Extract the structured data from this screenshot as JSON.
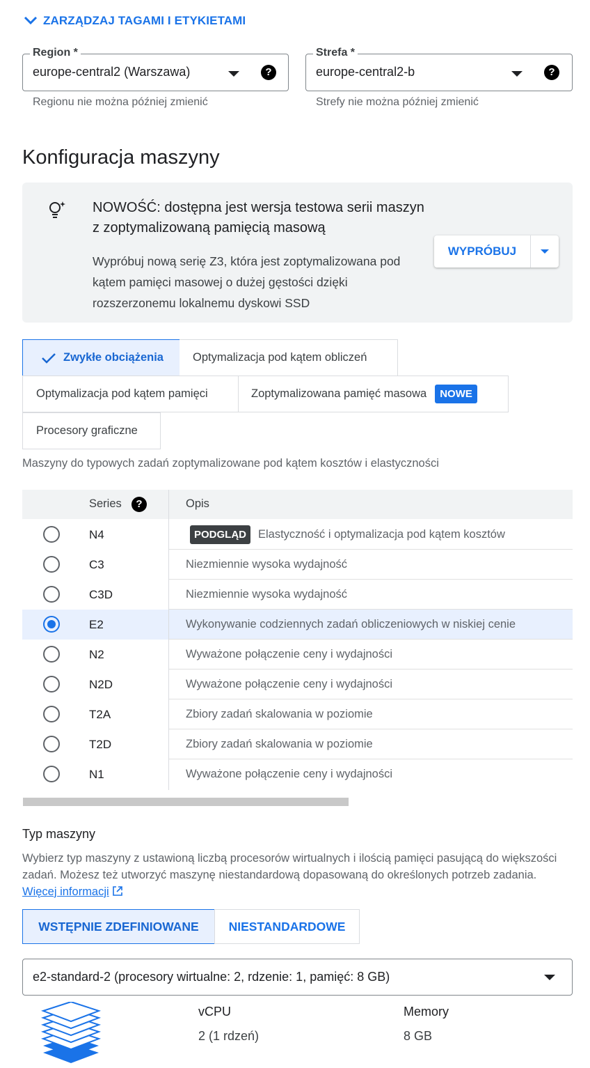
{
  "manage_tags": {
    "label": "ZARZĄDZAJ TAGAMI I ETYKIETAMI"
  },
  "region": {
    "label": "Region *",
    "value": "europe-central2 (Warszawa)",
    "hint": "Regionu nie można później zmienić"
  },
  "zone": {
    "label": "Strefa *",
    "value": "europe-central2-b",
    "hint": "Strefy nie można później zmienić"
  },
  "machine_config": {
    "title": "Konfiguracja maszyny"
  },
  "banner": {
    "title": "NOWOŚĆ: dostępna jest wersja testowa serii maszyn z zoptymalizowaną pamięcią masową",
    "description": "Wypróbuj nową serię Z3, która jest zoptymalizowana pod kątem pamięci masowej o dużej gęstości dzięki rozszerzonemu lokalnemu dyskowi SSD",
    "try_label": "WYPRÓBUJ"
  },
  "categories": {
    "general": "Zwykłe obciążenia",
    "compute": "Optymalizacja pod kątem obliczeń",
    "memory": "Optymalizacja pod kątem pamięci",
    "storage": "Zoptymalizowana pamięć masowa",
    "storage_badge": "NOWE",
    "gpu": "Procesory graficzne",
    "selected": "general",
    "description": "Maszyny do typowych zadań zoptymalizowane pod kątem kosztów i elastyczności"
  },
  "series_table": {
    "header_series": "Series",
    "header_desc": "Opis",
    "preview_badge": "PODGLĄD",
    "selected": "E2",
    "rows": [
      {
        "name": "N4",
        "desc": "Elastyczność i optymalizacja pod kątem kosztów"
      },
      {
        "name": "C3",
        "desc": "Niezmiennie wysoka wydajność"
      },
      {
        "name": "C3D",
        "desc": "Niezmiennie wysoka wydajność"
      },
      {
        "name": "E2",
        "desc": "Wykonywanie codziennych zadań obliczeniowych w niskiej cenie"
      },
      {
        "name": "N2",
        "desc": "Wyważone połączenie ceny i wydajności"
      },
      {
        "name": "N2D",
        "desc": "Wyważone połączenie ceny i wydajności"
      },
      {
        "name": "T2A",
        "desc": "Zbiory zadań skalowania w poziomie"
      },
      {
        "name": "T2D",
        "desc": "Zbiory zadań skalowania w poziomie"
      },
      {
        "name": "N1",
        "desc": "Wyważone połączenie ceny i wydajności"
      }
    ]
  },
  "machine_type": {
    "title": "Typ maszyny",
    "description": "Wybierz typ maszyny z ustawioną liczbą procesorów wirtualnych i ilością pamięci pasującą do większości zadań. Możesz też utworzyć maszynę niestandardową dopasowaną do określonych potrzeb zadania.",
    "learn_more": "Więcej informacji",
    "tab_predefined": "WSTĘPNIE ZDEFINIOWANE",
    "tab_custom": "NIESTANDARDOWE",
    "selected_tab": "predefined",
    "selected_value": "e2-standard-2 (procesory wirtualne: 2, rdzenie: 1, pamięć: 8 GB)",
    "vcpu_label": "vCPU",
    "vcpu_value": "2 (1 rdzeń)",
    "memory_label": "Memory",
    "memory_value": "8 GB"
  },
  "colors": {
    "accent": "#1a73e8",
    "selected_bg": "#e8f0fe",
    "banner_bg": "#f1f3f4"
  }
}
